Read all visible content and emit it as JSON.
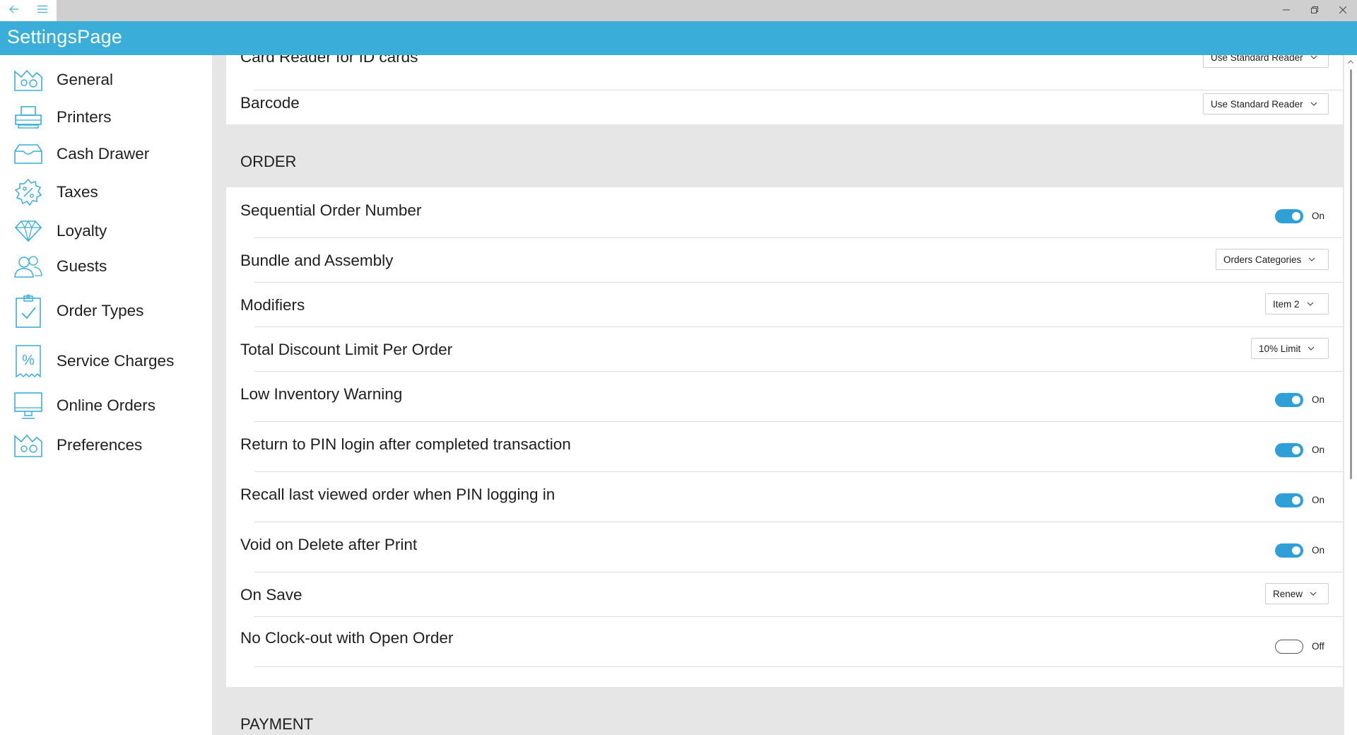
{
  "window": {
    "back_icon": "back-arrow-icon",
    "menu_icon": "hamburger-icon",
    "minimize_icon": "minimize-icon",
    "restore_icon": "restore-icon",
    "close_icon": "close-icon"
  },
  "app": {
    "title": "SettingsPage",
    "accent_color": "#3aaed8",
    "toggle_color": "#2f9fd8"
  },
  "sidebar": {
    "items": [
      {
        "label": "General",
        "icon": "general-icon"
      },
      {
        "label": "Printers",
        "icon": "printer-icon"
      },
      {
        "label": "Cash Drawer",
        "icon": "cash-drawer-icon"
      },
      {
        "label": "Taxes",
        "icon": "tax-icon"
      },
      {
        "label": "Loyalty",
        "icon": "diamond-icon"
      },
      {
        "label": "Guests",
        "icon": "guests-icon"
      },
      {
        "label": "Order Types",
        "icon": "clipboard-check-icon"
      },
      {
        "label": "Service Charges",
        "icon": "percent-receipt-icon"
      },
      {
        "label": "Online Orders",
        "icon": "monitor-icon"
      },
      {
        "label": "Preferences",
        "icon": "preferences-icon"
      }
    ]
  },
  "readers": {
    "card_reader": {
      "label": "Card Reader for ID cards",
      "value": "Use Standard Reader"
    },
    "barcode": {
      "label": "Barcode",
      "value": "Use Standard Reader"
    }
  },
  "order": {
    "section_title": "ORDER",
    "sequential": {
      "label": "Sequential Order Number",
      "state": "On"
    },
    "bundle": {
      "label": "Bundle and Assembly",
      "value": "Orders Categories"
    },
    "modifiers": {
      "label": "Modifiers",
      "value": "Item 2"
    },
    "discount": {
      "label": "Total Discount Limit Per Order",
      "value": "10% Limit"
    },
    "low_inventory": {
      "label": "Low Inventory Warning",
      "state": "On"
    },
    "return_pin": {
      "label": "Return to PIN login after completed transaction",
      "state": "On"
    },
    "recall_order": {
      "label": "Recall last viewed order when PIN logging in",
      "state": "On"
    },
    "void_delete": {
      "label": "Void on Delete after Print",
      "state": "On"
    },
    "on_save": {
      "label": "On Save",
      "value": "Renew"
    },
    "no_clockout": {
      "label": "No Clock-out with Open Order",
      "state": "Off"
    }
  },
  "payment": {
    "section_title": "PAYMENT"
  }
}
